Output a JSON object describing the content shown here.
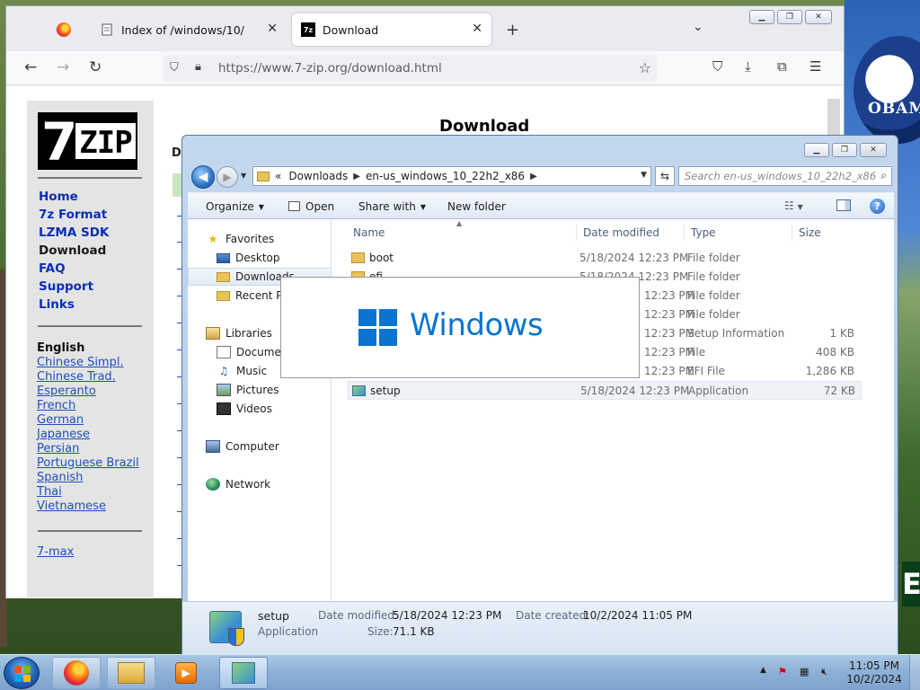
{
  "desktop": {
    "poster_text": "OBAM",
    "sign_letter": "E"
  },
  "browser": {
    "tabs": [
      {
        "title": "Index of /windows/10/",
        "icon": "page-icon"
      },
      {
        "title": "Download",
        "icon": "7zip-favicon",
        "favicon_text": "7z",
        "active": true
      }
    ],
    "url": "https://www.7-zip.org/download.html",
    "page": {
      "title": "Download",
      "stub_text": "De",
      "nav": [
        "Home",
        "7z Format",
        "LZMA SDK",
        "Download",
        "FAQ",
        "Support",
        "Links"
      ],
      "nav_current": "Download",
      "language_heading": "English",
      "languages": [
        "Chinese Simpl.",
        "Chinese Trad.",
        "Esperanto",
        "French",
        "German",
        "Japanese",
        "Persian",
        "Portuguese Brazil",
        "Spanish",
        "Thai",
        "Vietnamese"
      ],
      "extra_link": "7-max",
      "logo": {
        "seven": "7",
        "zip": "ZIP"
      }
    }
  },
  "explorer": {
    "path": [
      "«",
      "Downloads",
      "en-us_windows_10_22h2_x86"
    ],
    "search_placeholder": "Search en-us_windows_10_22h2_x86",
    "toolbar": {
      "organize": "Organize",
      "open": "Open",
      "share_with": "Share with",
      "new_folder": "New folder"
    },
    "nav": {
      "favorites": "Favorites",
      "desktop": "Desktop",
      "downloads": "Downloads",
      "recent": "Recent Pla",
      "libraries": "Libraries",
      "documents": "Documen",
      "music": "Music",
      "pictures": "Pictures",
      "videos": "Videos",
      "computer": "Computer",
      "network": "Network"
    },
    "columns": {
      "name": "Name",
      "date": "Date modified",
      "type": "Type",
      "size": "Size"
    },
    "files": [
      {
        "name": "boot",
        "date": "5/18/2024 12:23 PM",
        "type": "File folder",
        "size": "",
        "kind": "folder"
      },
      {
        "name": "efi",
        "date": "5/18/2024 12:23 PM",
        "type": "File folder",
        "size": "",
        "kind": "folder"
      },
      {
        "name": "",
        "date": "12:23 PM",
        "type": "File folder",
        "size": "",
        "kind": "folder"
      },
      {
        "name": "",
        "date": "12:23 PM",
        "type": "File folder",
        "size": "",
        "kind": "folder"
      },
      {
        "name": "",
        "date": "12:23 PM",
        "type": "Setup Information",
        "size": "1 KB",
        "kind": "file"
      },
      {
        "name": "",
        "date": "12:23 PM",
        "type": "File",
        "size": "408 KB",
        "kind": "file"
      },
      {
        "name": "",
        "date": "12:23 PM",
        "type": "EFI File",
        "size": "1,286 KB",
        "kind": "file"
      },
      {
        "name": "setup",
        "date": "5/18/2024 12:23 PM",
        "type": "Application",
        "size": "72 KB",
        "kind": "app"
      }
    ],
    "details": {
      "name": "setup",
      "type": "Application",
      "date_modified_label": "Date modified:",
      "date_modified": "5/18/2024 12:23 PM",
      "date_created_label": "Date created:",
      "date_created": "10/2/2024 11:05 PM",
      "size_label": "Size:",
      "size": "71.1 KB"
    }
  },
  "splash": {
    "text": "Windows"
  },
  "taskbar": {
    "time": "11:05 PM",
    "date": "10/2/2024"
  }
}
